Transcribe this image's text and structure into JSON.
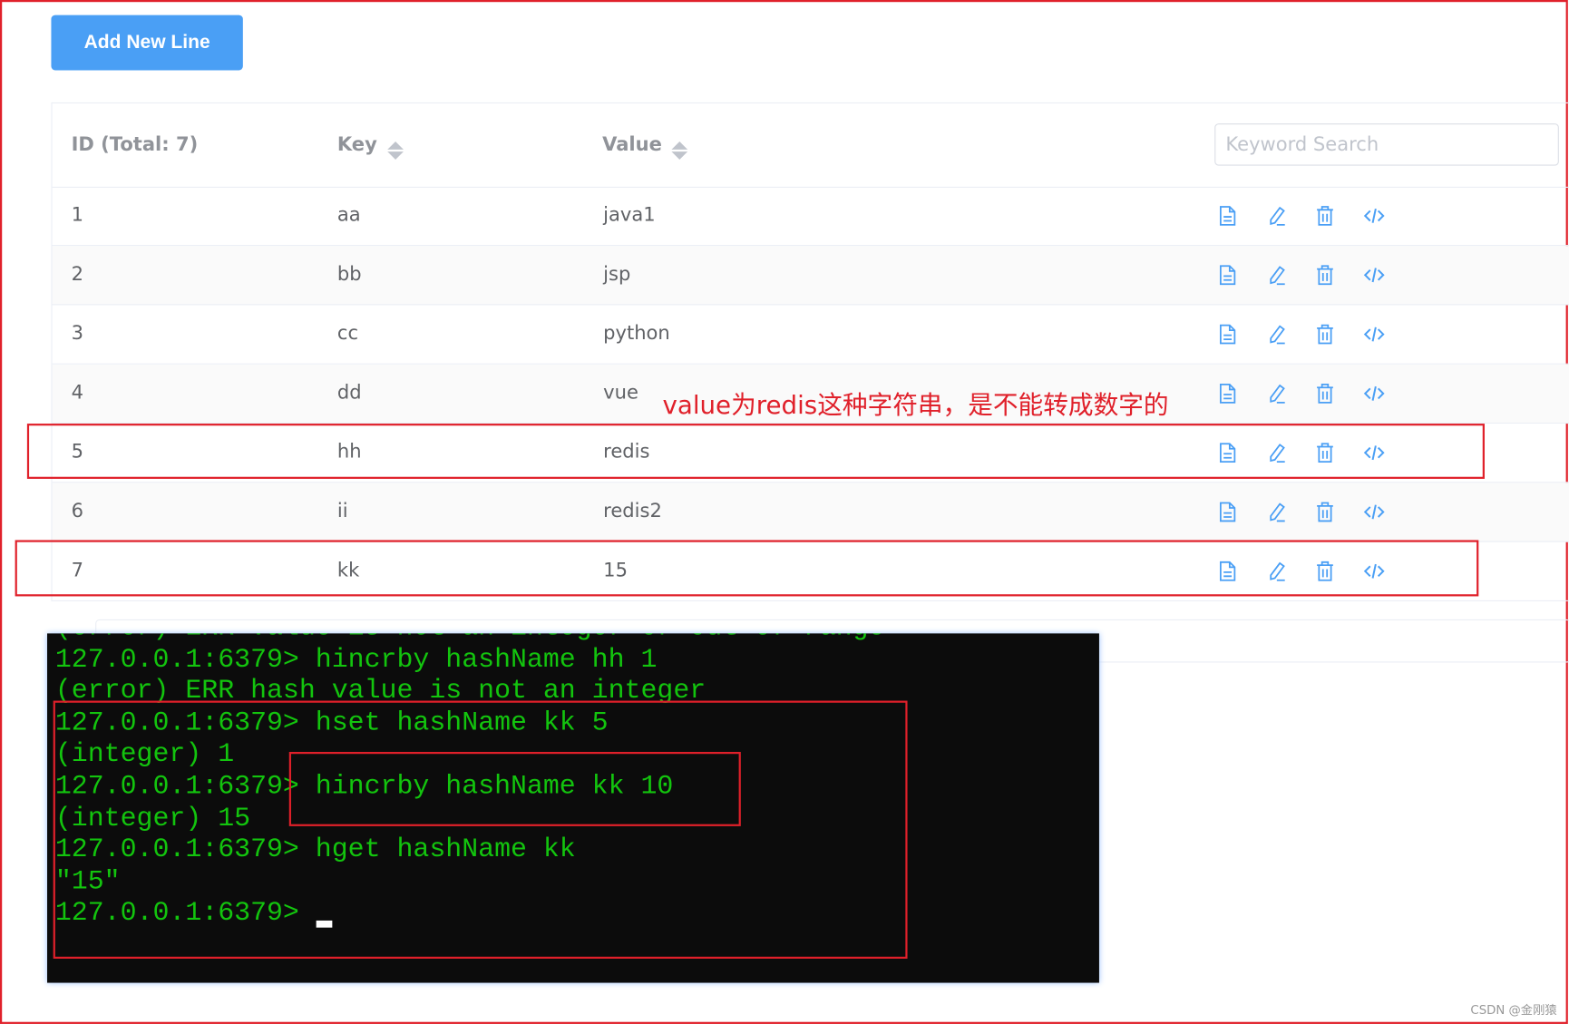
{
  "toolbar": {
    "add_label": "Add New Line"
  },
  "table": {
    "headers": {
      "id": "ID (Total: 7)",
      "key": "Key",
      "value": "Value"
    },
    "search": {
      "placeholder": "Keyword Search",
      "value": ""
    },
    "rows": [
      {
        "id": "1",
        "key": "aa",
        "value": "java1"
      },
      {
        "id": "2",
        "key": "bb",
        "value": "jsp"
      },
      {
        "id": "3",
        "key": "cc",
        "value": "python"
      },
      {
        "id": "4",
        "key": "dd",
        "value": "vue"
      },
      {
        "id": "5",
        "key": "hh",
        "value": "redis"
      },
      {
        "id": "6",
        "key": "ii",
        "value": "redis2"
      },
      {
        "id": "7",
        "key": "kk",
        "value": "15"
      }
    ],
    "row_actions": [
      "document-icon",
      "edit-icon",
      "delete-icon",
      "code-icon"
    ]
  },
  "annotation": "value为redis这种字符串，是不能转成数字的",
  "terminal": {
    "lines": [
      "(error) ERR value is not an integer or out of range",
      "127.0.0.1:6379> hincrby hashName hh 1",
      "(error) ERR hash value is not an integer",
      "127.0.0.1:6379> hset hashName kk 5",
      "(integer) 1",
      "127.0.0.1:6379> hincrby hashName kk 10",
      "(integer) 15",
      "127.0.0.1:6379> hget hashName kk",
      "\"15\"",
      "127.0.0.1:6379> "
    ]
  },
  "watermark": "CSDN @金刚猿",
  "colors": {
    "accent": "#4a9ff5",
    "annotation": "#e0202a",
    "terminal_text": "#13c40e",
    "terminal_bg": "#0c0c0c"
  }
}
